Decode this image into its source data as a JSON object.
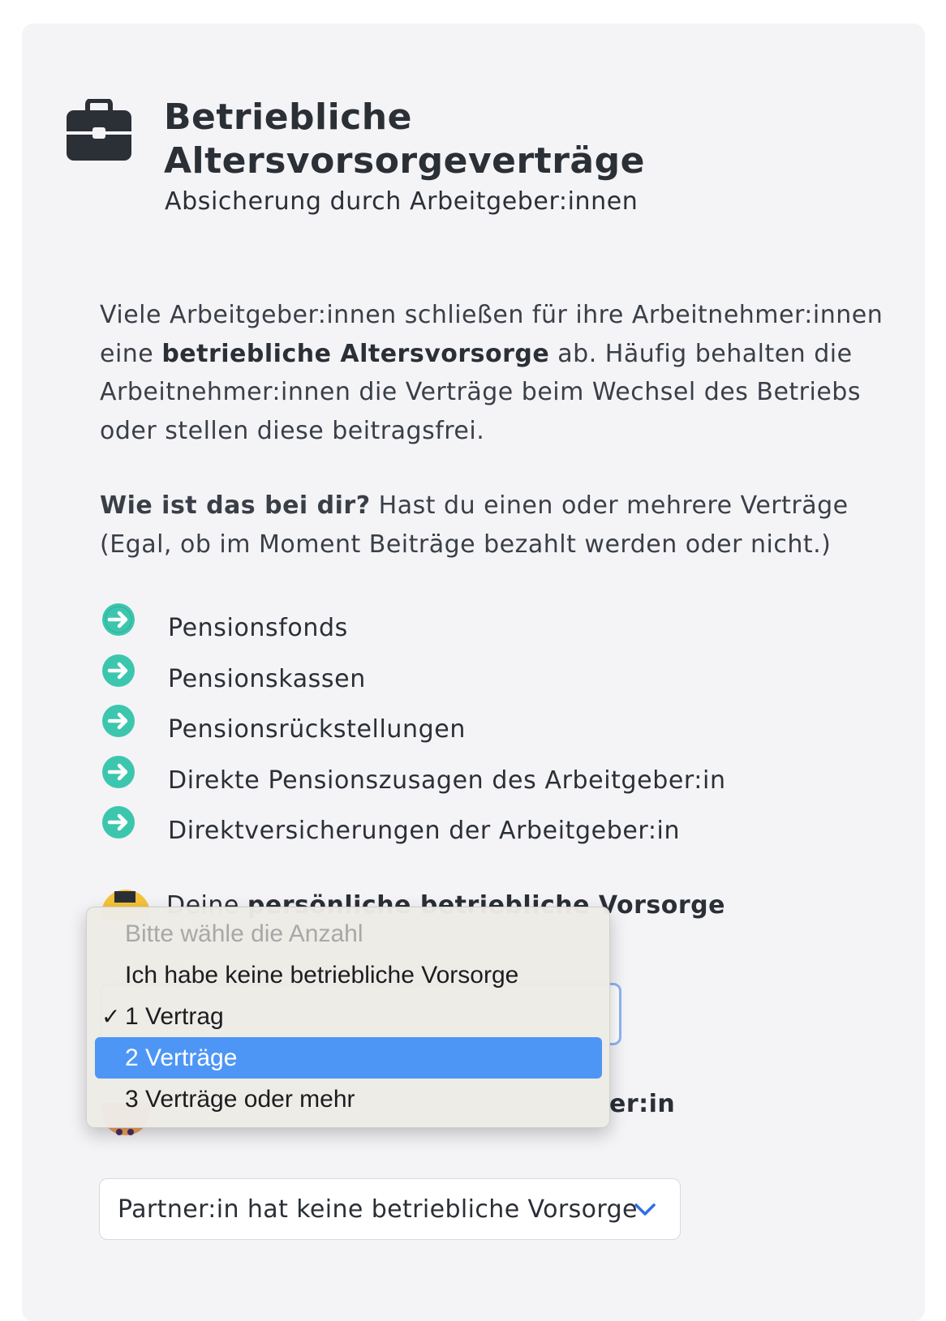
{
  "header": {
    "title": "Betriebliche Altersvorsorgeverträge",
    "subtitle": "Absicherung durch Arbeitgeber:innen",
    "icon": "briefcase-icon"
  },
  "intro": {
    "text_1": "Viele Arbeitgeber:innen schließen für ihre Arbeitnehmer:innen eine ",
    "bold": "betriebliche Altersvorsorge",
    "text_2": " ab. Häufig behalten die Arbeitnehmer:innen die Verträge beim Wechsel des Betriebs oder stellen diese beitragsfrei."
  },
  "question": {
    "bold": "Wie ist das bei dir?",
    "text": " Hast du einen oder mehrere Verträge (Egal, ob im Moment Beiträge bezahlt werden oder nicht.)"
  },
  "list": [
    {
      "label": "Pensionsfonds"
    },
    {
      "label": "Pensionskassen"
    },
    {
      "label": "Pensionsrückstellungen"
    },
    {
      "label": "Direkte Pensionszusagen des Arbeitgeber:in"
    },
    {
      "label": "Direktversicherungen der Arbeitgeber:in"
    }
  ],
  "own_section": {
    "label_prefix": "Deine ",
    "label_bold": "persönliche betriebliche Vorsorge"
  },
  "partner_section": {
    "label_visible_tail": "er:in",
    "select_value": "Partner:in hat keine betriebliche Vorsorge"
  },
  "dropdown": {
    "options": [
      {
        "label": "Bitte wähle die Anzahl",
        "disabled": true
      },
      {
        "label": "Ich habe keine betriebliche Vorsorge"
      },
      {
        "label": "1 Vertrag",
        "checked": true
      },
      {
        "label": "2 Verträge",
        "highlighted": true
      },
      {
        "label": "3 Verträge oder mehr"
      }
    ],
    "check_mark": "✓"
  },
  "colors": {
    "accent_teal": "#3cc6ae",
    "highlight_blue": "#4e96f5",
    "text_dark": "#2b2f36",
    "chevron_blue": "#2f6fe4"
  }
}
